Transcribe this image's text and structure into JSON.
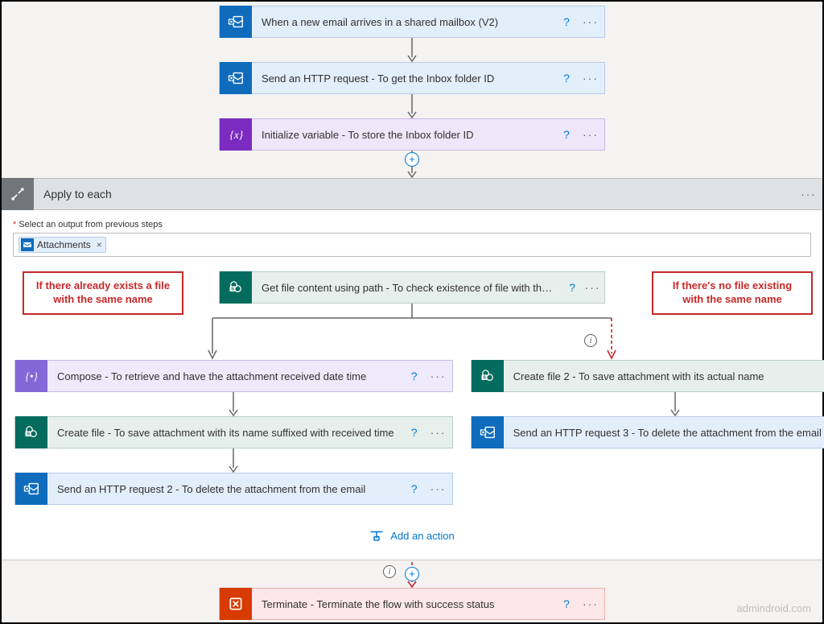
{
  "top": {
    "trigger": "When a new email arrives in a shared mailbox (V2)",
    "http1": "Send an HTTP request - To get the Inbox folder ID",
    "initvar": "Initialize variable - To store the Inbox folder ID"
  },
  "ate": {
    "title": "Apply to each",
    "fieldLabel": "Select an output from previous steps",
    "tokenLabel": "Attachments",
    "getFile": "Get file content using path - To check existence of file with the same name",
    "left": {
      "compose": "Compose - To retrieve and have the attachment received date time",
      "createFile": "Create file - To save attachment with its name suffixed with received time",
      "http2": "Send an HTTP request 2 - To delete the attachment from the email"
    },
    "right": {
      "createFile2": "Create file 2 - To save attachment with its actual name",
      "http3": "Send an HTTP request 3 - To delete the attachment from the email"
    },
    "addAction": "Add an action"
  },
  "callouts": {
    "left": "If there already exists a file with the same name",
    "right": "If there's no file existing with the same name"
  },
  "terminate": "Terminate - Terminate the flow with success status",
  "watermark": "admindroid.com",
  "glyph": {
    "help": "?",
    "more": "···",
    "close": "×",
    "plus": "+",
    "info": "i"
  }
}
